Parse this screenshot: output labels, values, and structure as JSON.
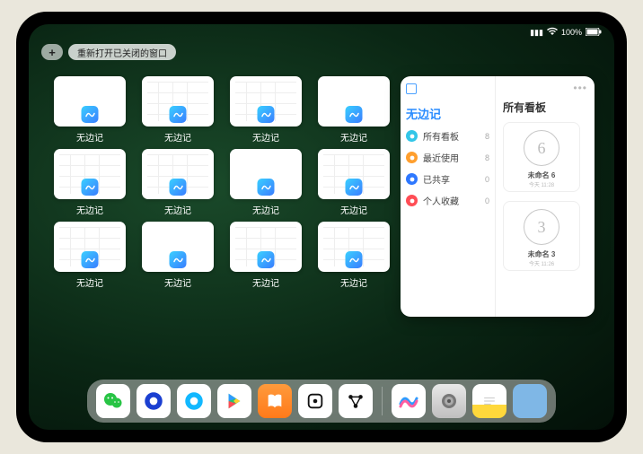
{
  "status": {
    "battery_text": "100%",
    "wifi": "wifi-icon",
    "signal": "signal-icon"
  },
  "controls": {
    "plus_label": "+",
    "reopen_label": "重新打开已关闭的窗口"
  },
  "app_name": "无边记",
  "thumbnails": [
    {
      "label": "无边记",
      "style": "blank"
    },
    {
      "label": "无边记",
      "style": "grid"
    },
    {
      "label": "无边记",
      "style": "grid"
    },
    {
      "label": "无边记",
      "style": "blank"
    },
    {
      "label": "无边记",
      "style": "grid"
    },
    {
      "label": "无边记",
      "style": "grid"
    },
    {
      "label": "无边记",
      "style": "blank"
    },
    {
      "label": "无边记",
      "style": "grid"
    },
    {
      "label": "无边记",
      "style": "grid"
    },
    {
      "label": "无边记",
      "style": "blank"
    },
    {
      "label": "无边记",
      "style": "grid"
    },
    {
      "label": "无边记",
      "style": "grid"
    }
  ],
  "sidebar": {
    "title": "无边记",
    "items": [
      {
        "icon_color": "#33c6e8",
        "label": "所有看板",
        "count": 8
      },
      {
        "icon_color": "#ff9f2e",
        "label": "最近使用",
        "count": 8
      },
      {
        "icon_color": "#2e78ff",
        "label": "已共享",
        "count": 0
      },
      {
        "icon_color": "#ff4d55",
        "label": "个人收藏",
        "count": 0
      }
    ],
    "right_title": "所有看板",
    "more": "•••",
    "boards": [
      {
        "sketch": "6",
        "label": "未命名 6",
        "sub": "今天 11:28"
      },
      {
        "sketch": "3",
        "label": "未命名 3",
        "sub": "今天 11:26"
      }
    ]
  },
  "dock": {
    "apps": [
      {
        "name": "wechat-icon"
      },
      {
        "name": "browser-blue-icon"
      },
      {
        "name": "browser-cyan-icon"
      },
      {
        "name": "play-store-icon"
      },
      {
        "name": "books-icon"
      },
      {
        "name": "dice-icon"
      },
      {
        "name": "graph-icon"
      }
    ],
    "recent": [
      {
        "name": "freeform-icon"
      },
      {
        "name": "settings-icon"
      },
      {
        "name": "notes-icon"
      },
      {
        "name": "app-library-icon"
      }
    ]
  }
}
